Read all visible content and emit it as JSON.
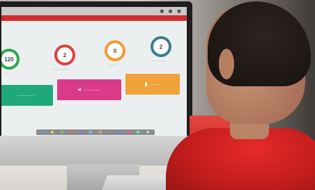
{
  "dashboard": {
    "stats": [
      {
        "value": "120",
        "color": "#2fa84f"
      },
      {
        "value": "2",
        "color": "#e0403a"
      },
      {
        "value": "0",
        "color": "#f29a32"
      },
      {
        "value": "2",
        "color": "#3a7d8c"
      }
    ],
    "tiles": [
      {
        "icon": "",
        "color": "#1fa97a"
      },
      {
        "icon": "share-icon",
        "color": "#d93a8a"
      },
      {
        "icon": "bookmark-icon",
        "color": "#f0a33a"
      }
    ],
    "accent": "#d32b2b"
  }
}
